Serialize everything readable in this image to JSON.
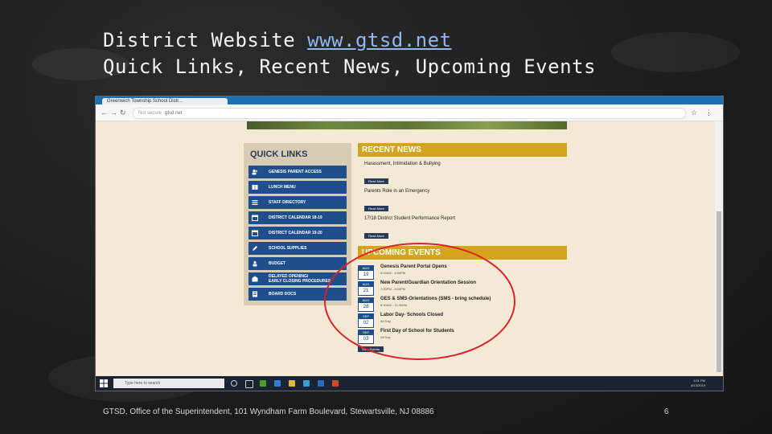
{
  "slide": {
    "title_line1_prefix": "District Website ",
    "title_line1_link": "www.gtsd.net",
    "title_line2": "Quick Links, Recent News, Upcoming Events",
    "footer": "GTSD, Office of the Superintendent, 101 Wyndham Farm Boulevard, Stewartsville, NJ 08886",
    "page_number": "6"
  },
  "browser": {
    "tab_title": "Greenwich Township School Distr...",
    "url_security": "Not secure",
    "url": "gtsd.net"
  },
  "quick_links": {
    "title": "QUICK LINKS",
    "items": [
      {
        "label": "GENESIS PARENT ACCESS",
        "icon": "users-icon"
      },
      {
        "label": "LUNCH MENU",
        "icon": "book-icon"
      },
      {
        "label": "STAFF DIRECTORY",
        "icon": "list-icon"
      },
      {
        "label": "DISTRICT CALENDAR 18-19",
        "icon": "calendar-icon"
      },
      {
        "label": "DISTRICT CALENDAR 19-20",
        "icon": "calendar-icon"
      },
      {
        "label": "SCHOOL SUPPLIES",
        "icon": "pencil-icon"
      },
      {
        "label": "BUDGET",
        "icon": "users-icon"
      },
      {
        "label_line1": "DELAYED OPENING/",
        "label_line2": "EARLY CLOSING PROCEDURES",
        "icon": "building-icon"
      },
      {
        "label": "BOARD DOCS",
        "icon": "document-icon"
      }
    ]
  },
  "recent_news": {
    "title": "RECENT NEWS",
    "items": [
      {
        "title": "Harassment, Intimidation & Bullying",
        "button": "Read More"
      },
      {
        "title": "Parents Role in an Emergency",
        "button": "Read More"
      },
      {
        "title": "17/18 District Student Performance Report",
        "button": "Read More"
      }
    ]
  },
  "upcoming_events": {
    "title": "UPCOMING EVENTS",
    "items": [
      {
        "month": "AUG",
        "day": "19",
        "title": "Genesis Parent Portal Opens",
        "time": "8:00AM - 4:00PM"
      },
      {
        "month": "AUG",
        "day": "21",
        "title": "New Parent/Guardian Orientation Session",
        "time": "7:00PM - 8:00PM"
      },
      {
        "month": "AUG",
        "day": "28",
        "title": "GES & SMS-Orientations (SMS - bring schedule)",
        "time": "8:30AM - 11:30AM"
      },
      {
        "month": "SEP",
        "day": "02",
        "title": "Labor Day- Schools Closed",
        "time": "All Day"
      },
      {
        "month": "SEP",
        "day": "03",
        "title": "First Day of School for Students",
        "time": "All Day"
      }
    ],
    "view_button": "View Events"
  },
  "taskbar": {
    "search_placeholder": "Type here to search",
    "time": "1:01 PM",
    "date": "8/13/2019"
  },
  "colors": {
    "quick_link_blue": "#1f4e8c",
    "section_gold": "#d4a41d",
    "annotation_red": "#d8232a"
  }
}
